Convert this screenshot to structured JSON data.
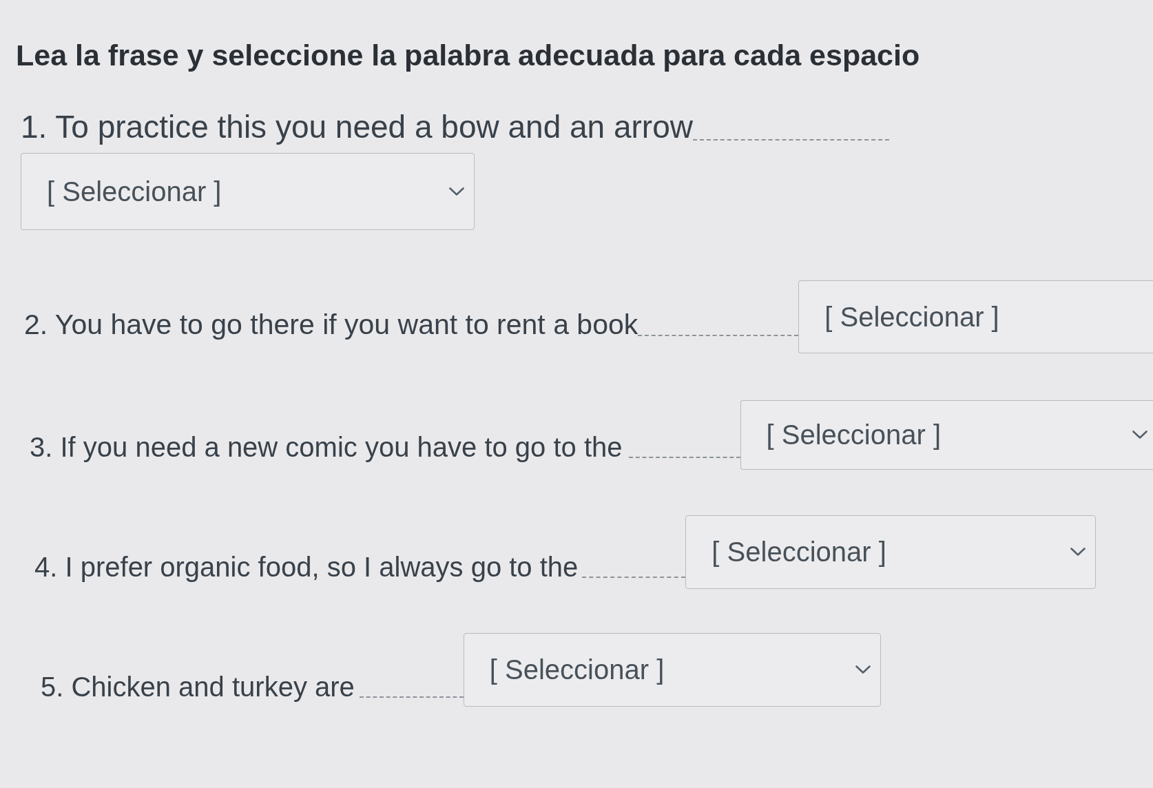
{
  "instructions": "Lea la frase y seleccione la palabra adecuada para cada espacio",
  "questions": [
    {
      "kind": "stacked",
      "sentence": "1. To practice this you need a bow and an arrow",
      "dropdown": {
        "value": "[ Seleccionar ]",
        "chevron": true,
        "cut_off": false
      }
    },
    {
      "kind": "inline",
      "sentence": "2. You have to go there if you want to rent a book",
      "dropdown": {
        "value": "[ Seleccionar ]",
        "chevron": false,
        "cut_off": true
      }
    },
    {
      "kind": "inline",
      "sentence": "3. If you need a new comic you have to go to the",
      "dropdown": {
        "value": "[ Seleccionar ]",
        "chevron": true,
        "cut_off": true
      }
    },
    {
      "kind": "inline",
      "sentence": "4. I prefer organic food, so I always go to the",
      "dropdown": {
        "value": "[ Seleccionar ]",
        "chevron": true,
        "cut_off": false
      }
    },
    {
      "kind": "inline",
      "sentence": "5. Chicken and turkey are",
      "dropdown": {
        "value": "[ Seleccionar ]",
        "chevron": true,
        "cut_off": false
      }
    }
  ]
}
